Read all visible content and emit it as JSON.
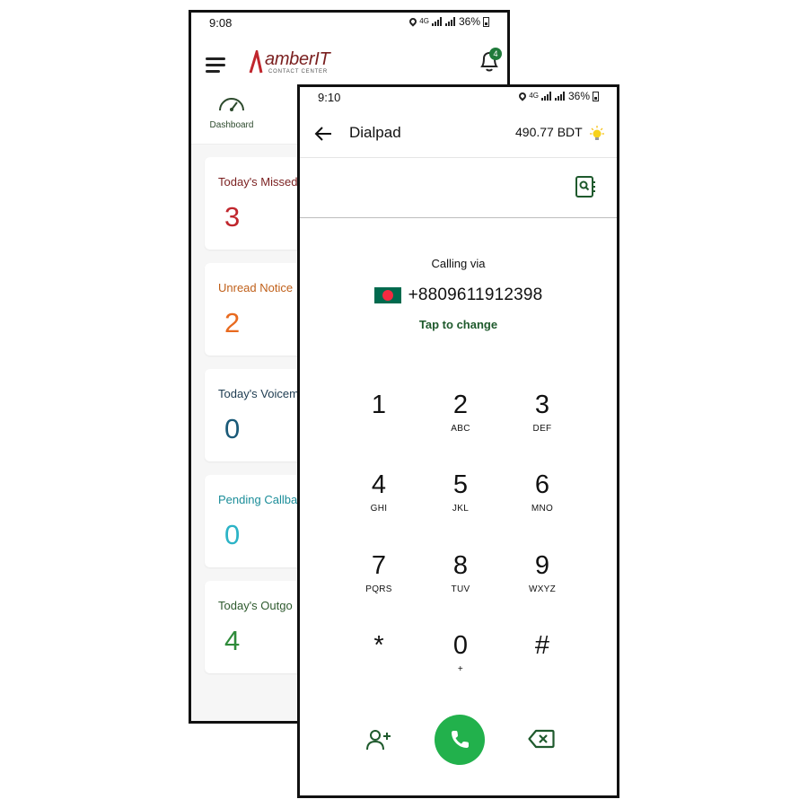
{
  "back_screen": {
    "status": {
      "time": "9:08",
      "network": "4G",
      "battery": "36%"
    },
    "logo": {
      "main": "amberIT",
      "sub": "CONTACT CENTER"
    },
    "notification_count": "4",
    "tab": {
      "label": "Dashboard"
    },
    "cards": [
      {
        "label": "Today's Missed",
        "value": "3",
        "label_color": "#7a1f1f",
        "value_color": "#c0262d"
      },
      {
        "label": "Unread Notice",
        "value": "2",
        "label_color": "#c0601a",
        "value_color": "#e86a1f"
      },
      {
        "label": "Today's Voicem",
        "value": "0",
        "label_color": "#1d3b50",
        "value_color": "#1a5a78"
      },
      {
        "label": "Pending Callba",
        "value": "0",
        "label_color": "#1b8d99",
        "value_color": "#2cb3c6"
      },
      {
        "label": "Today's Outgo",
        "value": "4",
        "label_color": "#2e5a2e",
        "value_color": "#2e8b3a"
      }
    ]
  },
  "front_screen": {
    "status": {
      "time": "9:10",
      "network": "4G",
      "battery": "36%"
    },
    "header": {
      "title": "Dialpad",
      "balance": "490.77 BDT"
    },
    "calling_via": "Calling via",
    "caller_number": "+8809611912398",
    "tap_to_change": "Tap to change",
    "keys": [
      {
        "digit": "1",
        "letters": ""
      },
      {
        "digit": "2",
        "letters": "ABC"
      },
      {
        "digit": "3",
        "letters": "DEF"
      },
      {
        "digit": "4",
        "letters": "GHI"
      },
      {
        "digit": "5",
        "letters": "JKL"
      },
      {
        "digit": "6",
        "letters": "MNO"
      },
      {
        "digit": "7",
        "letters": "PQRS"
      },
      {
        "digit": "8",
        "letters": "TUV"
      },
      {
        "digit": "9",
        "letters": "WXYZ"
      },
      {
        "digit": "*",
        "letters": ""
      },
      {
        "digit": "0",
        "letters": "+"
      },
      {
        "digit": "#",
        "letters": ""
      }
    ],
    "icons": {
      "add_contact": "add-contact-icon",
      "call": "phone-icon",
      "backspace": "backspace-icon",
      "contacts": "contact-book-icon",
      "bulb": "bulb-icon"
    },
    "colors": {
      "accent": "#22b14c",
      "dark_green": "#1f5a2d"
    }
  }
}
